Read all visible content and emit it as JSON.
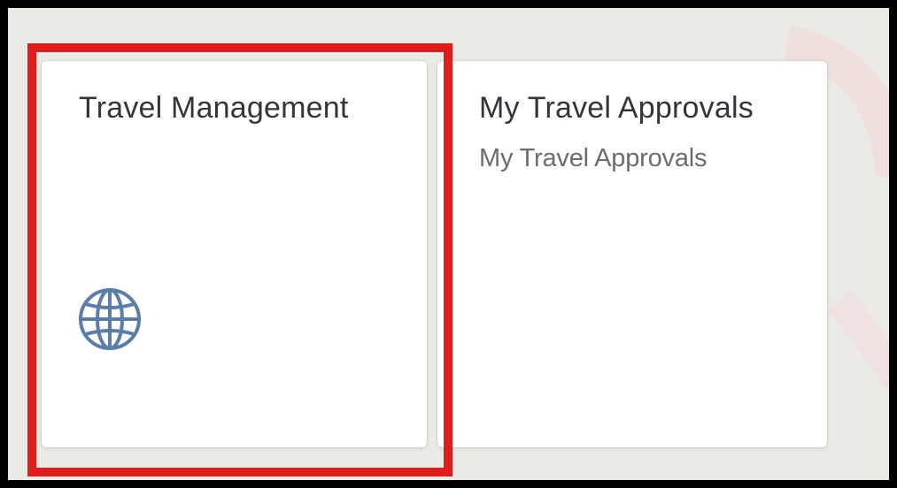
{
  "tiles": [
    {
      "title": "Travel Management",
      "subtitle": "",
      "icon": "globe-icon",
      "highlighted": true
    },
    {
      "title": "My Travel Approvals",
      "subtitle": "My Travel Approvals",
      "icon": "",
      "highlighted": false
    }
  ],
  "colors": {
    "highlight": "#e01c1c",
    "icon": "#5b7da8",
    "title_text": "#32363a",
    "subtitle_text": "#6a6d70",
    "background": "#eceae6"
  }
}
